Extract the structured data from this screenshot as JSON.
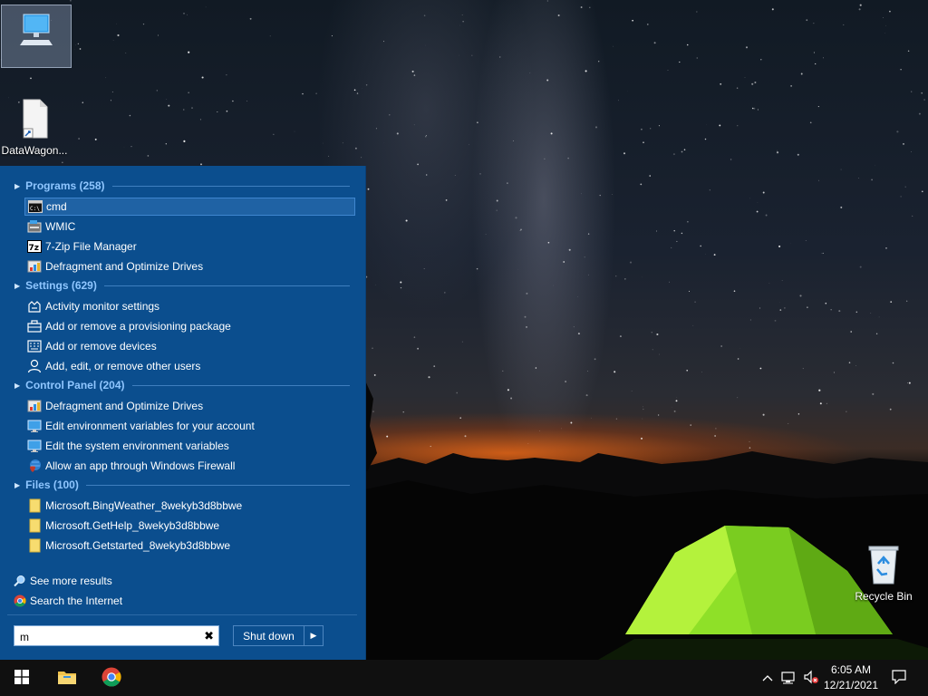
{
  "desktop": {
    "icons": [
      {
        "label": "",
        "icon": "this-pc-icon"
      },
      {
        "label": "DataWagon...",
        "icon": "file-shortcut-icon"
      },
      {
        "label": "Recycle Bin",
        "icon": "recycle-bin-icon"
      }
    ]
  },
  "start_menu": {
    "sections": [
      {
        "label": "Programs (258)",
        "items": [
          {
            "label": "cmd",
            "icon": "cmd-icon",
            "selected": true
          },
          {
            "label": "WMIC",
            "icon": "wmic-icon"
          },
          {
            "label": "7-Zip File Manager",
            "icon": "7zip-icon"
          },
          {
            "label": "Defragment and Optimize Drives",
            "icon": "defrag-icon"
          }
        ]
      },
      {
        "label": "Settings (629)",
        "items": [
          {
            "label": "Activity monitor settings",
            "icon": "activity-monitor-icon"
          },
          {
            "label": "Add or remove a provisioning package",
            "icon": "briefcase-icon"
          },
          {
            "label": "Add or remove devices",
            "icon": "keyboard-icon"
          },
          {
            "label": "Add, edit, or remove other users",
            "icon": "user-icon"
          }
        ]
      },
      {
        "label": "Control Panel (204)",
        "items": [
          {
            "label": "Defragment and Optimize Drives",
            "icon": "defrag-icon"
          },
          {
            "label": "Edit environment variables for your account",
            "icon": "monitor-icon"
          },
          {
            "label": "Edit the system environment variables",
            "icon": "monitor-icon"
          },
          {
            "label": "Allow an app through Windows Firewall",
            "icon": "firewall-icon"
          }
        ]
      },
      {
        "label": "Files (100)",
        "items": [
          {
            "label": "Microsoft.BingWeather_8wekyb3d8bbwe",
            "icon": "folder-icon"
          },
          {
            "label": "Microsoft.GetHelp_8wekyb3d8bbwe",
            "icon": "folder-icon"
          },
          {
            "label": "Microsoft.Getstarted_8wekyb3d8bbwe",
            "icon": "folder-icon"
          }
        ]
      }
    ],
    "see_more": "See more results",
    "search_internet": "Search the Internet",
    "search_value": "m",
    "shutdown_label": "Shut down"
  },
  "taskbar": {
    "time": "6:05 AM",
    "date": "12/21/2021"
  },
  "colors": {
    "start_menu_bg": "#0b4e8e",
    "section_header": "#8fc6ff",
    "selected_item": "#1f62a4",
    "taskbar_bg": "#101010"
  }
}
